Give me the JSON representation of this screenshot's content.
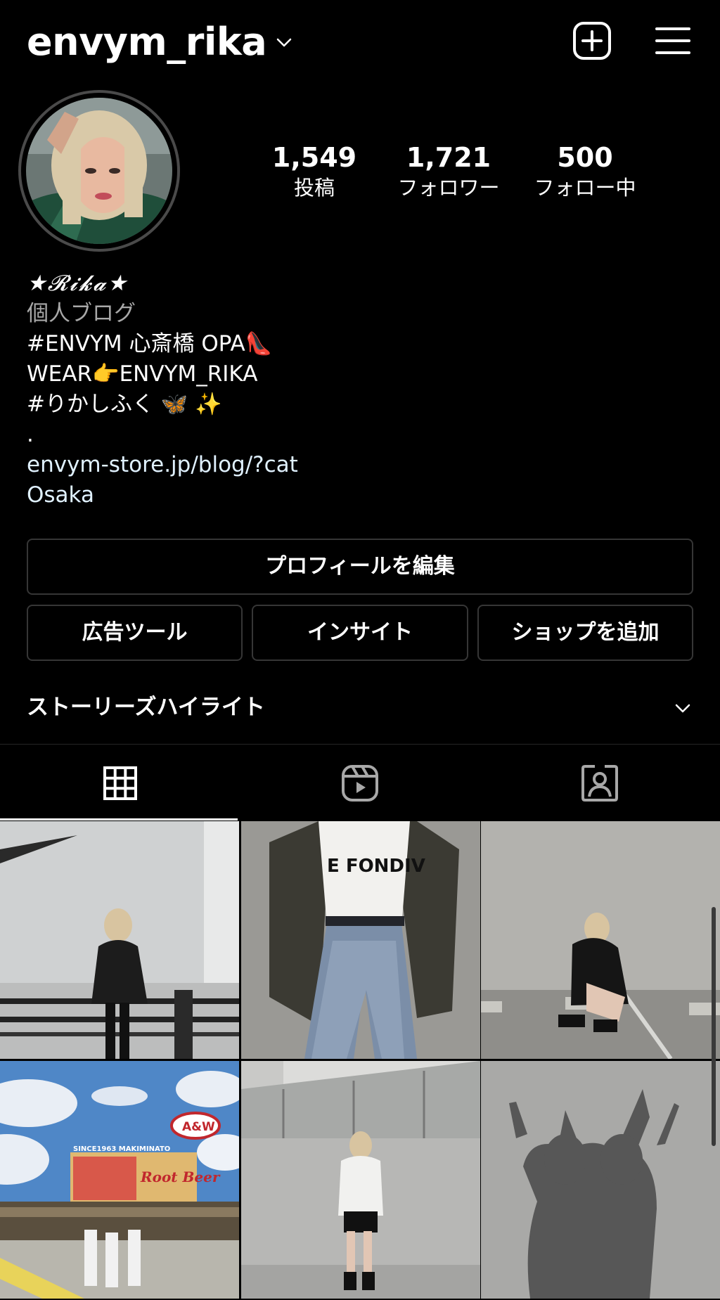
{
  "header": {
    "username": "envym_rika",
    "icons": {
      "dropdown": "chevron-down-icon",
      "add": "plus-square-icon",
      "menu": "hamburger-menu-icon"
    }
  },
  "profile": {
    "stats": [
      {
        "value": "1,549",
        "label": "投稿"
      },
      {
        "value": "1,721",
        "label": "フォロワー"
      },
      {
        "value": "500",
        "label": "フォロー中"
      }
    ],
    "bio": {
      "name": "★𝓡𝓲𝓴𝓪★",
      "category": "個人ブログ",
      "lines": [
        "#ENVYM 心斎橋 OPA👠",
        "WEAR👉ENVYM_RIKA",
        "#りかしふく 🦋 ✨",
        "."
      ],
      "link": "envym-store.jp/blog/?cat",
      "location": "Osaka"
    }
  },
  "buttons": {
    "edit_profile": "プロフィールを編集",
    "ad_tools": "広告ツール",
    "insights": "インサイト",
    "add_shop": "ショップを追加"
  },
  "highlights": {
    "title": "ストーリーズハイライト"
  },
  "tabs": [
    {
      "name": "posts-grid",
      "icon": "grid-icon",
      "active": true
    },
    {
      "name": "reels",
      "icon": "reels-icon",
      "active": false
    },
    {
      "name": "tagged",
      "icon": "tagged-person-icon",
      "active": false
    }
  ],
  "grid_text": {
    "tshirt_print": "E FONDIV",
    "sign_brand": "A&W",
    "sign_slogan": "Root Beer",
    "sign_place": "SINCE1963 MAKIMINATO"
  },
  "colors": {
    "background": "#000000",
    "text": "#ffffff",
    "secondary_text": "#a8a8a8",
    "link": "#e0f1ff",
    "border": "#363636"
  }
}
